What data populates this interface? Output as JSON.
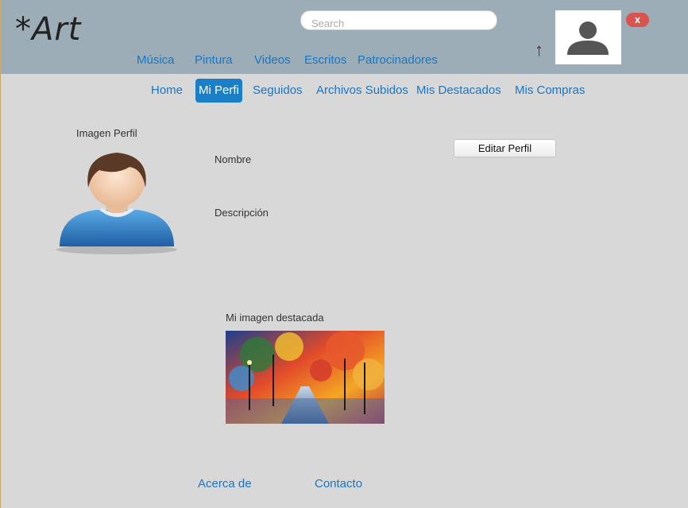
{
  "header": {
    "logo": "*Art",
    "search_placeholder": "Search",
    "categories": [
      "Música",
      "Pintura",
      "Videos",
      "Escritos",
      "Patrocinadores"
    ],
    "close_label": "x"
  },
  "subnav": {
    "items": [
      "Home",
      "Mi Perfi",
      "Seguidos",
      "Archivos Subidos",
      "Mis Destacados",
      "Mis Compras"
    ],
    "active_index": 1
  },
  "profile": {
    "image_label": "Imagen Perfil",
    "name_label": "Nombre",
    "description_label": "Descripción",
    "edit_button": "Editar Perfil",
    "featured_label": "Mi imagen destacada"
  },
  "footer": {
    "about": "Acerca de",
    "contact": "Contacto"
  },
  "colors": {
    "header_bg": "#9cadb8",
    "page_bg": "#d8d8d8",
    "link": "#1a76c2",
    "active_tab": "#1b7fc7",
    "close_button": "#d9534f"
  }
}
